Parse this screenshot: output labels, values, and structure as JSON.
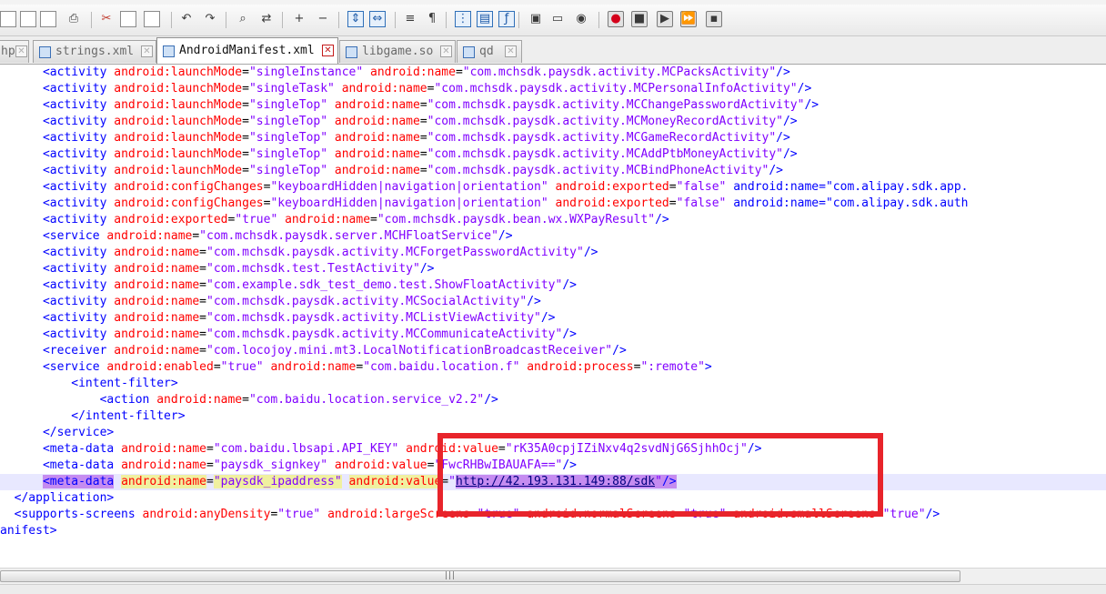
{
  "colors": {
    "tag": "#0000ff",
    "attribute": "#ff0000",
    "value": "#8000ff",
    "annotation": "#e8242b",
    "current_line": "#e8e8ff",
    "match_highlight": "#c58cf0"
  },
  "toolbar": {
    "icons": [
      "new-file-icon",
      "open-file-icon",
      "close-file-icon",
      "print-icon",
      "cut-icon",
      "copy-icon",
      "paste-icon",
      "undo-icon",
      "redo-icon",
      "find-icon",
      "replace-icon",
      "zoom-in-icon",
      "zoom-out-icon",
      "sync-vertical-icon",
      "sync-horizontal-icon",
      "word-wrap-icon",
      "show-all-chars-icon",
      "indent-guide-icon",
      "document-map-icon",
      "function-list-icon",
      "monitor-icon",
      "folder-as-workspace-icon",
      "eye-icon",
      "record-macro-icon",
      "stop-recording-icon",
      "playback-macro-icon",
      "run-macro-multiple-icon",
      "save-macro-icon"
    ]
  },
  "tabs": [
    {
      "label": "hp",
      "active": false
    },
    {
      "label": "strings.xml",
      "active": false
    },
    {
      "label": "AndroidManifest.xml",
      "active": true
    },
    {
      "label": "libgame.so",
      "active": false
    },
    {
      "label": "qd",
      "active": false
    }
  ],
  "editor": {
    "lines": [
      "      <activity android:launchMode=\"singleInstance\" android:name=\"com.mchsdk.paysdk.activity.MCPacksActivity\"/>",
      "      <activity android:launchMode=\"singleTask\" android:name=\"com.mchsdk.paysdk.activity.MCPersonalInfoActivity\"/>",
      "      <activity android:launchMode=\"singleTop\" android:name=\"com.mchsdk.paysdk.activity.MCChangePasswordActivity\"/>",
      "      <activity android:launchMode=\"singleTop\" android:name=\"com.mchsdk.paysdk.activity.MCMoneyRecordActivity\"/>",
      "      <activity android:launchMode=\"singleTop\" android:name=\"com.mchsdk.paysdk.activity.MCGameRecordActivity\"/>",
      "      <activity android:launchMode=\"singleTop\" android:name=\"com.mchsdk.paysdk.activity.MCAddPtbMoneyActivity\"/>",
      "      <activity android:launchMode=\"singleTop\" android:name=\"com.mchsdk.paysdk.activity.MCBindPhoneActivity\"/>",
      "      <activity android:configChanges=\"keyboardHidden|navigation|orientation\" android:exported=\"false\" android:name=\"com.alipay.sdk.app.",
      "      <activity android:configChanges=\"keyboardHidden|navigation|orientation\" android:exported=\"false\" android:name=\"com.alipay.sdk.auth",
      "      <activity android:exported=\"true\" android:name=\"com.mchsdk.paysdk.bean.wx.WXPayResult\"/>",
      "      <service android:name=\"com.mchsdk.paysdk.server.MCHFloatService\"/>",
      "      <activity android:name=\"com.mchsdk.paysdk.activity.MCForgetPasswordActivity\"/>",
      "      <activity android:name=\"com.mchsdk.test.TestActivity\"/>",
      "      <activity android:name=\"com.example.sdk_test_demo.test.ShowFloatActivity\"/>",
      "      <activity android:name=\"com.mchsdk.paysdk.activity.MCSocialActivity\"/>",
      "      <activity android:name=\"com.mchsdk.paysdk.activity.MCListViewActivity\"/>",
      "      <activity android:name=\"com.mchsdk.paysdk.activity.MCCommunicateActivity\"/>",
      "      <receiver android:name=\"com.locojoy.mini.mt3.LocalNotificationBroadcastReceiver\"/>",
      "      <service android:enabled=\"true\" android:name=\"com.baidu.location.f\" android:process=\":remote\">",
      "          <intent-filter>",
      "              <action android:name=\"com.baidu.location.service_v2.2\"/>",
      "          </intent-filter>",
      "      </service>",
      "      <meta-data android:name=\"com.baidu.lbsapi.API_KEY\" android:value=\"rK35A0cpjIZiNxv4q2svdNjG6SjhhOcj\"/>",
      "      <meta-data android:name=\"paysdk_signkey\" android:value=\"FwcRHBwIBAUAFA==\"/>",
      "      <meta-data android:name=\"paysdk_ipaddress\" android:value=\"http://42.193.131.149:88/sdk\"/>",
      "  </application>",
      "  <supports-screens android:anyDensity=\"true\" android:largeScreens=\"true\" android:normalScreens=\"true\" android:smallScreens=\"true\"/>",
      "anifest>"
    ],
    "current_line_index": 25
  },
  "scrollbar": {
    "grip": "|||"
  }
}
